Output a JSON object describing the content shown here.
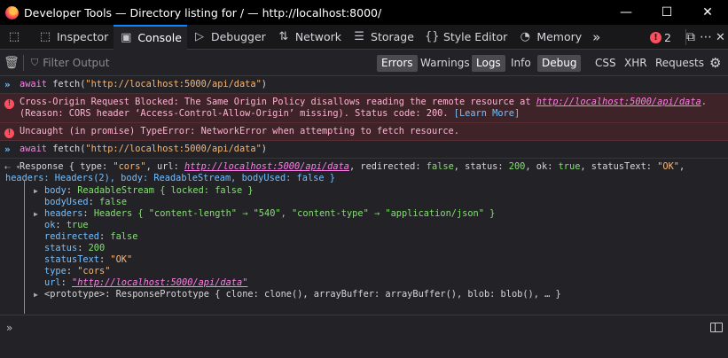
{
  "window": {
    "title": "Developer Tools — Directory listing for / — http://localhost:8000/",
    "controls": {
      "minimize": "—",
      "maximize": "☐",
      "close": "✕"
    }
  },
  "tabs": [
    {
      "label": "Inspector",
      "icon": "inspector-icon",
      "glyph": "⬚"
    },
    {
      "label": "Console",
      "icon": "console-icon",
      "glyph": "▣",
      "selected": true
    },
    {
      "label": "Debugger",
      "icon": "debugger-icon",
      "glyph": "▷"
    },
    {
      "label": "Network",
      "icon": "network-icon",
      "glyph": "⇅"
    },
    {
      "label": "Storage",
      "icon": "storage-icon",
      "glyph": "☰"
    },
    {
      "label": "Style Editor",
      "icon": "style-editor-icon",
      "glyph": "{}"
    },
    {
      "label": "Memory",
      "icon": "memory-icon",
      "glyph": "◔"
    }
  ],
  "toolbar_right": {
    "error_count": "2",
    "more": "»",
    "dock": "⧉",
    "menu": "⋯",
    "close": "✕"
  },
  "filter": {
    "placeholder": "Filter Output",
    "chips": [
      {
        "label": "Errors",
        "on": true
      },
      {
        "label": "Warnings",
        "on": false
      },
      {
        "label": "Logs",
        "on": true
      },
      {
        "label": "Info",
        "on": false
      },
      {
        "label": "Debug",
        "on": true
      },
      {
        "label": "CSS",
        "on": false
      },
      {
        "label": "XHR",
        "on": false
      },
      {
        "label": "Requests",
        "on": false
      }
    ]
  },
  "console": {
    "input1": {
      "await": "await",
      "fn": "fetch",
      "arg": "\"http://localhost:5000/api/data\""
    },
    "error1": {
      "text1": "Cross-Origin Request Blocked: The Same Origin Policy disallows reading the remote resource at ",
      "url": "http://localhost:5000/api/data",
      "text2": ".",
      "text3": "(Reason: CORS header ‘Access-Control-Allow-Origin’ missing). Status code: 200. ",
      "learn": "[Learn More]"
    },
    "error2": {
      "text": "Uncaught (in promise) TypeError: NetworkError when attempting to fetch resource."
    },
    "input2": {
      "await": "await",
      "fn": "fetch",
      "arg": "\"http://localhost:5000/api/data\""
    },
    "result": {
      "line1_a": "Response { type: ",
      "type_val": "\"cors\"",
      "line1_b": ", url: ",
      "url": "http://localhost:5000/api/data",
      "line1_c": ", redirected: ",
      "redirected": "false",
      "line1_d": ", status: ",
      "status": "200",
      "line1_e": ", ok: ",
      "ok": "true",
      "line1_f": ", statusText: ",
      "statusText": "\"OK\"",
      "line1_g": ",",
      "line2": "headers: Headers(2), body: ReadableStream, bodyUsed: false }",
      "props": [
        {
          "twisty": true,
          "key": "body",
          "val": "ReadableStream { locked: false }"
        },
        {
          "twisty": false,
          "key": "bodyUsed",
          "val": "false"
        },
        {
          "twisty": true,
          "key": "headers",
          "val": "Headers { \"content-length\" → \"540\", \"content-type\" → \"application/json\" }"
        },
        {
          "twisty": false,
          "key": "ok",
          "val": "true"
        },
        {
          "twisty": false,
          "key": "redirected",
          "val": "false"
        },
        {
          "twisty": false,
          "key": "status",
          "val": "200"
        },
        {
          "twisty": false,
          "key": "statusText",
          "val": "\"OK\""
        },
        {
          "twisty": false,
          "key": "type",
          "val": "\"cors\""
        },
        {
          "twisty": false,
          "key": "url",
          "val": "\"http://localhost:5000/api/data\""
        },
        {
          "twisty": true,
          "key": "<prototype>",
          "val": "ResponsePrototype { clone: clone(), arrayBuffer: arrayBuffer(), blob: blob(), … }"
        }
      ]
    }
  },
  "prompt": {
    "chevron": "»"
  }
}
